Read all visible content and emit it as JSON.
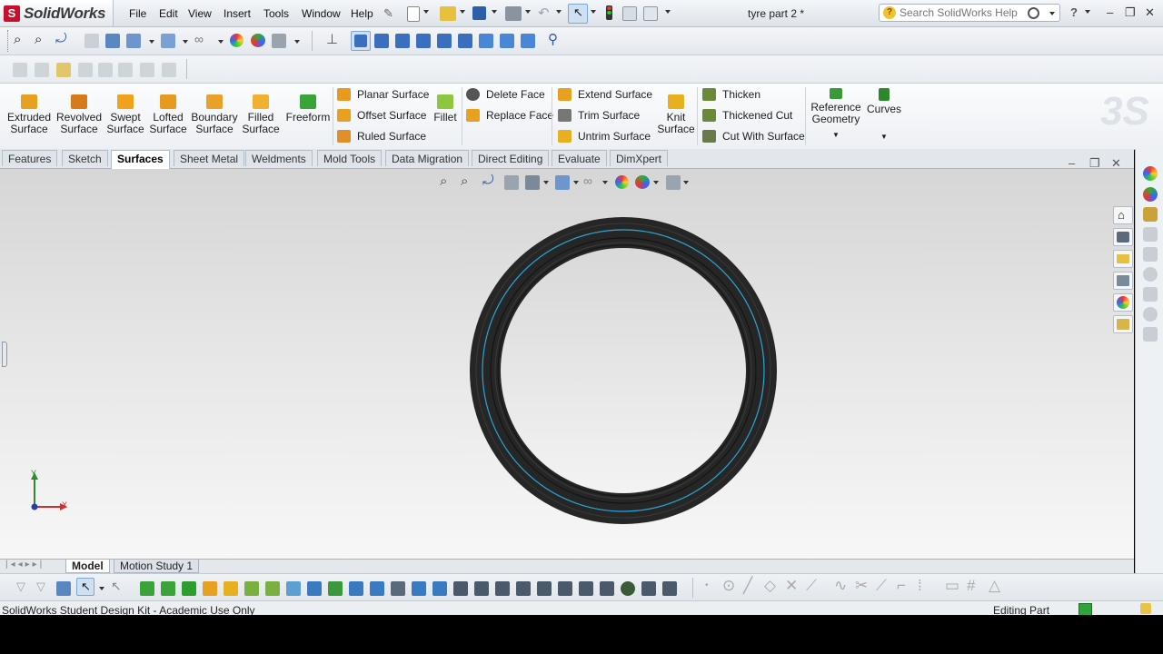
{
  "app": {
    "name": "SolidWorks",
    "document_title": "tyre part 2 *"
  },
  "menu": [
    "File",
    "Edit",
    "View",
    "Insert",
    "Tools",
    "Window",
    "Help"
  ],
  "search": {
    "placeholder": "Search SolidWorks Help"
  },
  "command_manager": {
    "big_buttons": [
      {
        "label1": "Extruded",
        "label2": "Surface",
        "icon": "extruded-surface-icon",
        "color": "#e8a020"
      },
      {
        "label1": "Revolved",
        "label2": "Surface",
        "icon": "revolved-surface-icon",
        "color": "#d77a1a"
      },
      {
        "label1": "Swept",
        "label2": "Surface",
        "icon": "swept-surface-icon",
        "color": "#f0a21c"
      },
      {
        "label1": "Lofted",
        "label2": "Surface",
        "icon": "lofted-surface-icon",
        "color": "#e89a20"
      },
      {
        "label1": "Boundary",
        "label2": "Surface",
        "icon": "boundary-surface-icon",
        "color": "#e8a22a"
      },
      {
        "label1": "Filled",
        "label2": "Surface",
        "icon": "filled-surface-icon",
        "color": "#f0b030"
      },
      {
        "label1": "Freeform",
        "label2": "",
        "icon": "freeform-icon",
        "color": "#3aa33a"
      }
    ],
    "small_col1": [
      {
        "label": "Planar Surface",
        "icon": "planar-surface-icon",
        "color": "#e89a20"
      },
      {
        "label": "Offset Surface",
        "icon": "offset-surface-icon",
        "color": "#e8a020"
      },
      {
        "label": "Ruled Surface",
        "icon": "ruled-surface-icon",
        "color": "#e0902a"
      }
    ],
    "fillet": {
      "label": "Fillet",
      "icon": "fillet-icon",
      "color": "#8ec63f"
    },
    "small_col2": [
      {
        "label": "Delete Face",
        "icon": "delete-face-icon",
        "color": "#555555"
      },
      {
        "label": "Replace Face",
        "icon": "replace-face-icon",
        "color": "#e8a020"
      }
    ],
    "small_col3": [
      {
        "label": "Extend Surface",
        "icon": "extend-surface-icon",
        "color": "#e8a020"
      },
      {
        "label": "Trim Surface",
        "icon": "trim-surface-icon",
        "color": "#777777"
      },
      {
        "label": "Untrim Surface",
        "icon": "untrim-surface-icon",
        "color": "#e8b020"
      }
    ],
    "knit": {
      "label1": "Knit",
      "label2": "Surface",
      "icon": "knit-surface-icon",
      "color": "#e8b020"
    },
    "small_col4": [
      {
        "label": "Thicken",
        "icon": "thicken-icon",
        "color": "#6a8a3a"
      },
      {
        "label": "Thickened Cut",
        "icon": "thickened-cut-icon",
        "color": "#6a8a3a"
      },
      {
        "label": "Cut With Surface",
        "icon": "cut-with-surface-icon",
        "color": "#6a7a4a"
      }
    ],
    "reference_geometry": {
      "label1": "Reference",
      "label2": "Geometry",
      "icon": "reference-geometry-icon",
      "color": "#3a9a3a"
    },
    "curves": {
      "label": "Curves",
      "icon": "curves-icon",
      "color": "#2a8a2a"
    }
  },
  "tabs": [
    "Features",
    "Sketch",
    "Surfaces",
    "Sheet Metal",
    "Weldments",
    "Mold Tools",
    "Data Migration",
    "Direct Editing",
    "Evaluate",
    "DimXpert"
  ],
  "active_tab": "Surfaces",
  "bottom_tabs": [
    "Model",
    "Motion Study 1"
  ],
  "triad": {
    "x": "X",
    "y": "Y"
  },
  "status": {
    "left": "SolidWorks Student Design Kit - Academic Use Only",
    "right": "Editing Part"
  },
  "colors": {
    "accent_blue": "#3a8fd6",
    "tyre": "#262626",
    "tyre_line": "#2aa6d8"
  }
}
